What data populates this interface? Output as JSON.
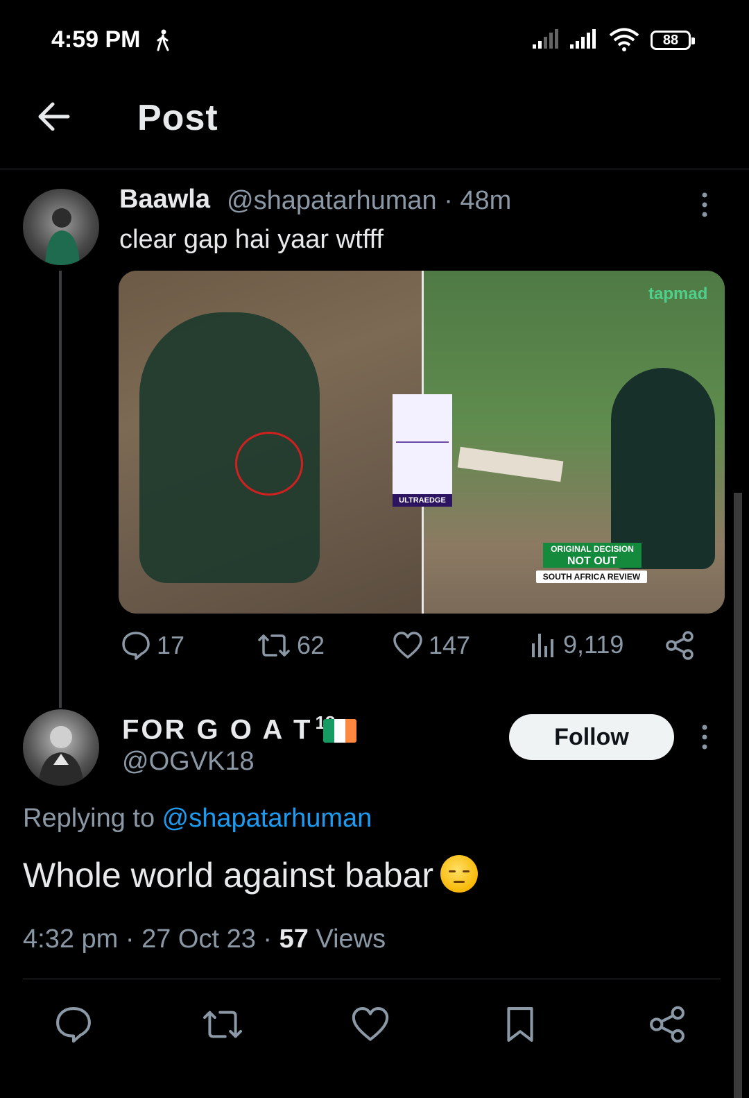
{
  "status_bar": {
    "time": "4:59 PM",
    "battery": "88",
    "icons": [
      "walking-icon",
      "signal-icon",
      "signal-icon",
      "wifi-icon",
      "battery-icon"
    ]
  },
  "header": {
    "title": "Post",
    "back_icon": "arrow-left-icon"
  },
  "post": {
    "display_name": "Baawla",
    "handle_time": "@shapatarhuman · 48m",
    "text": "clear gap hai yaar wtfff",
    "media": {
      "tapmad": "tapmad",
      "ultraedge": "ULTRAEDGE",
      "decision_top": "ORIGINAL DECISION",
      "decision_mid": "NOT OUT",
      "decision_bot": "SOUTH AFRICA REVIEW"
    },
    "actions": {
      "replies": "17",
      "retweets": "62",
      "likes": "147",
      "views": "9,119"
    }
  },
  "reply": {
    "display_name": "FOR G O A T",
    "superscript": "18",
    "handle": "@OGVK18",
    "follow_label": "Follow",
    "replying_prefix": "Replying to ",
    "replying_mention": "@shapatarhuman",
    "text": "Whole world against babar",
    "time_date": "4:32 pm · 27 Oct 23 · ",
    "views_count": "57",
    "views_label": " Views"
  },
  "colors": {
    "accent": "#1d9bf0",
    "text": "#e7e9ea",
    "muted": "#8b98a5",
    "divider": "#2f3336"
  }
}
